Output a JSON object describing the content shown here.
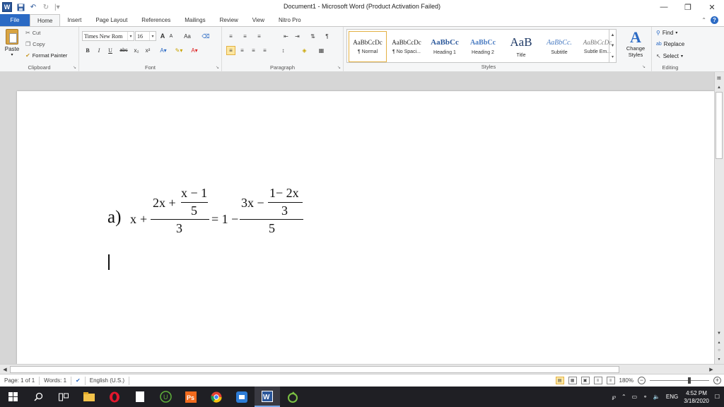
{
  "window": {
    "title": "Document1 - Microsoft Word (Product Activation Failed)",
    "controls": {
      "minimize": "—",
      "restore": "❐",
      "close": "✕"
    }
  },
  "quick_access": {
    "app_logo": "W",
    "save_icon": "save-icon",
    "undo_icon": "undo-icon",
    "redo_icon": "redo-icon"
  },
  "tabs": [
    "File",
    "Home",
    "Insert",
    "Page Layout",
    "References",
    "Mailings",
    "Review",
    "View",
    "Nitro Pro"
  ],
  "active_tab": "Home",
  "ribbon": {
    "clipboard": {
      "label": "Clipboard",
      "paste": "Paste",
      "cut": "Cut",
      "copy": "Copy",
      "format_painter": "Format Painter"
    },
    "font": {
      "label": "Font",
      "font_name": "Times New Rom",
      "font_size": "16",
      "grow": "A",
      "shrink": "A",
      "change_case": "Aa",
      "bold": "B",
      "italic": "I",
      "underline": "U",
      "strike": "abc",
      "subscript": "x₂",
      "superscript": "x²"
    },
    "paragraph": {
      "label": "Paragraph",
      "pilcrow": "¶"
    },
    "styles": {
      "label": "Styles",
      "items": [
        {
          "sample": "AaBbCcDc",
          "name": "¶ Normal"
        },
        {
          "sample": "AaBbCcDc",
          "name": "¶ No Spaci..."
        },
        {
          "sample": "AaBbCc",
          "name": "Heading 1"
        },
        {
          "sample": "AaBbCc",
          "name": "Heading 2"
        },
        {
          "sample": "AaB",
          "name": "Title"
        },
        {
          "sample": "AaBbCc.",
          "name": "Subtitle"
        },
        {
          "sample": "AaBbCcDc",
          "name": "Subtle Em..."
        }
      ],
      "change_styles": "Change Styles"
    },
    "editing": {
      "label": "Editing",
      "find": "Find",
      "replace": "Replace",
      "select": "Select"
    }
  },
  "equation": {
    "label": "a)",
    "x": "x",
    "plus": "+",
    "left_num_a": "2x +",
    "left_inner_num": "x − 1",
    "left_inner_den": "5",
    "left_den": "3",
    "equals": "= 1 −",
    "right_num_a": "3x −",
    "right_inner_num": "1− 2x",
    "right_inner_den": "3",
    "right_den": "5"
  },
  "statusbar": {
    "page": "Page: 1 of 1",
    "words": "Words: 1",
    "language": "English (U.S.)",
    "zoom": "180%"
  },
  "taskbar": {
    "language": "ENG",
    "time": "4:52 PM",
    "date": "3/18/2020"
  },
  "colors": {
    "accent": "#2b6ac4",
    "word_blue": "#2b579a",
    "taskbar": "#1f1f24"
  }
}
